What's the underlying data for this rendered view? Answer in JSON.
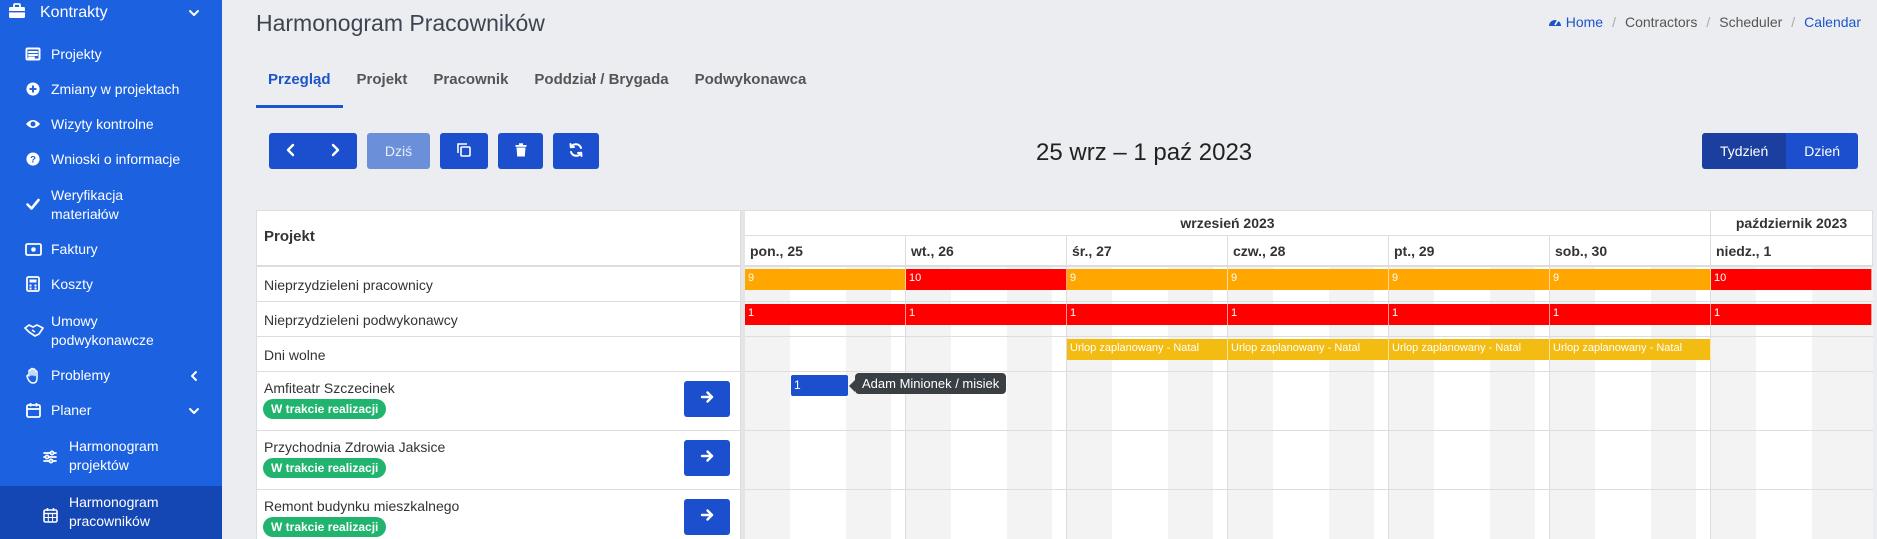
{
  "sidebar": {
    "top": {
      "label": "Kontrakty",
      "icon": "briefcase-icon"
    },
    "items": [
      {
        "label": "Projekty",
        "icon": "list-icon"
      },
      {
        "label": "Zmiany w projektach",
        "icon": "plus-circle-icon"
      },
      {
        "label": "Wizyty kontrolne",
        "icon": "eye-icon"
      },
      {
        "label": "Wnioski o informacje",
        "icon": "question-circle-icon"
      },
      {
        "label1": "Weryfikacja",
        "label2": "materiałów",
        "icon": "check-icon"
      },
      {
        "label": "Faktury",
        "icon": "money-icon"
      },
      {
        "label": "Koszty",
        "icon": "calculator-icon"
      },
      {
        "label1": "Umowy",
        "label2": "podwykonawcze",
        "icon": "handshake-icon"
      },
      {
        "label": "Problemy",
        "icon": "hand-icon"
      },
      {
        "label": "Planer",
        "icon": "calendar-icon"
      }
    ],
    "sub_items": [
      {
        "label1": "Harmonogram",
        "label2": "projektów",
        "icon": "sliders-icon"
      },
      {
        "label1": "Harmonogram",
        "label2": "pracowników",
        "icon": "calendar-grid-icon"
      }
    ]
  },
  "header": {
    "title": "Harmonogram Pracowników",
    "breadcrumb": [
      "Home",
      "Contractors",
      "Scheduler",
      "Calendar"
    ]
  },
  "tabs": [
    "Przegląd",
    "Projekt",
    "Pracownik",
    "Poddział / Brygada",
    "Podwykonawca"
  ],
  "toolbar": {
    "today": "Dziś",
    "range_title": "25 wrz – 1 paź 2023",
    "views": [
      "Tydzień",
      "Dzień"
    ]
  },
  "scheduler": {
    "resource_header": "Projekt",
    "months": [
      "wrzesień 2023",
      "październik 2023"
    ],
    "days": [
      "pon., 25",
      "wt., 26",
      "śr., 27",
      "czw., 28",
      "pt., 29",
      "sob., 30",
      "niedz., 1"
    ],
    "rows": [
      {
        "name": "Nieprzydzieleni pracownicy"
      },
      {
        "name": "Nieprzydzieleni podwykonawcy"
      },
      {
        "name": "Dni wolne"
      },
      {
        "name": "Amfiteatr Szczecinek",
        "badge": "W trakcie realizacji"
      },
      {
        "name": "Przychodnia Zdrowia Jaksice",
        "badge": "W trakcie realizacji"
      },
      {
        "name": "Remont budynku mieszkalnego",
        "badge": "W trakcie realizacji"
      }
    ],
    "unassigned_workers": [
      "9",
      "10",
      "9",
      "9",
      "9",
      "9",
      "10"
    ],
    "unassigned_workers_colors": [
      "#ffa600",
      "#ff0000",
      "#ffa600",
      "#ffa600",
      "#ffa600",
      "#ffa600",
      "#ff0000"
    ],
    "unassigned_subcontractors": [
      "1",
      "1",
      "1",
      "1",
      "1",
      "1",
      "1"
    ],
    "days_off": [
      "Urlop zaplanowany - Natal",
      "Urlop zaplanowany - Natal",
      "Urlop zaplanowany - Natal",
      "Urlop zaplanowany - Natal"
    ],
    "event": {
      "label": "1",
      "tooltip": "Adam Minionek / misiek"
    }
  },
  "colors": {
    "sidebar": "#1c61e0",
    "primary": "#1b4fce",
    "orange": "#ffa600",
    "red": "#ff0000",
    "yellow": "#f2bc12",
    "badge": "#20b46e"
  }
}
